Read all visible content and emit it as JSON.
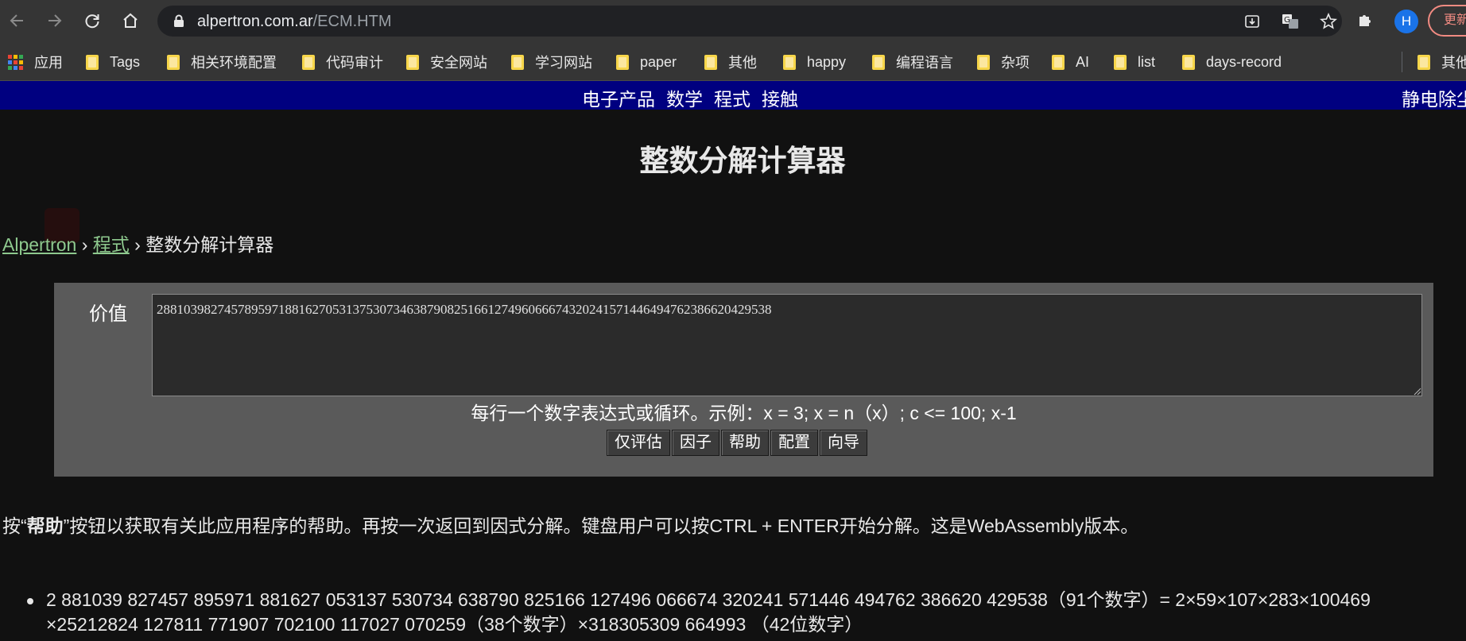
{
  "browser": {
    "url_host": "alpertron.com.ar",
    "url_path": "/ECM.HTM",
    "avatar_letter": "H",
    "update_label": "更新"
  },
  "bookmarks": [
    {
      "label": "应用"
    },
    {
      "label": "Tags"
    },
    {
      "label": "相关环境配置"
    },
    {
      "label": "代码审计"
    },
    {
      "label": "安全网站"
    },
    {
      "label": "学习网站"
    },
    {
      "label": "paper"
    },
    {
      "label": "其他"
    },
    {
      "label": "happy"
    },
    {
      "label": "编程语言"
    },
    {
      "label": "杂项"
    },
    {
      "label": "AI"
    },
    {
      "label": "list"
    },
    {
      "label": "days-record"
    },
    {
      "label": "其他"
    }
  ],
  "topnav": {
    "links": [
      "电子产品",
      "数学",
      "程式",
      "接触"
    ],
    "right": "静电除尘"
  },
  "page": {
    "title": "整数分解计算器",
    "breadcrumb": {
      "home": "Alpertron",
      "sep1": " › ",
      "section": "程式",
      "sep2": " › ",
      "current": "整数分解计算器"
    },
    "value_label": "价值",
    "value_input": "2881039827457895971881627053137530734638790825166127496066674320241571446494762386620429538",
    "hint": "每行一个数字表达式或循环。示例：x = 3; x = n（x）; c <= 100; x-1",
    "buttons": [
      "仅评估",
      "因子",
      "帮助",
      "配置",
      "向导"
    ],
    "help_pre": "按“",
    "help_bold": "帮助",
    "help_post": "”按钮以获取有关此应用程序的帮助。再按一次返回到因式分解。键盘用户可以按CTRL + ENTER开始分解。这是WebAssembly版本。",
    "result_line1": "2 881039 827457 895971 881627 053137 530734 638790 825166 127496 066674 320241 571446 494762 386620 429538（91个数字）= 2×59×107×283×100469",
    "result_line2": "×25212824 127811 771907 702100 117027 070259（38个数字）×318305309 664993 （42位数字）"
  },
  "colors": {
    "page_bg": "#111111",
    "nav_bg": "#000080",
    "panel_bg": "#5a5a5a",
    "link": "#8ec98e",
    "chrome_bg": "#353535"
  }
}
